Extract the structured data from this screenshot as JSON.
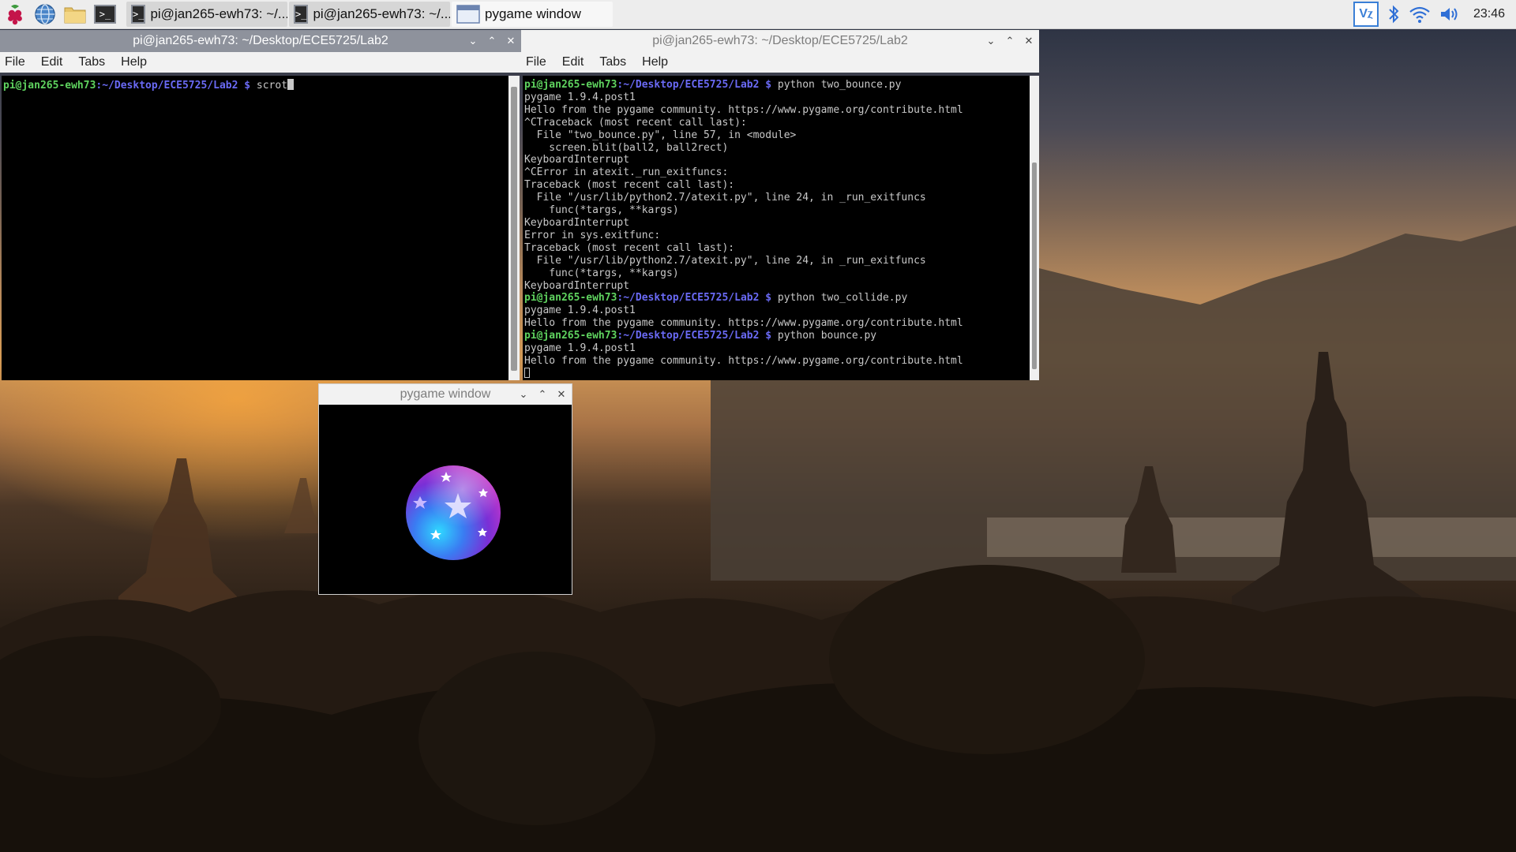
{
  "taskbar": {
    "tasks": [
      {
        "label": "pi@jan265-ewh73: ~/..."
      },
      {
        "label": "pi@jan265-ewh73: ~/..."
      },
      {
        "label": "pygame window"
      }
    ],
    "clock": "23:46"
  },
  "window_left": {
    "title": "pi@jan265-ewh73: ~/Desktop/ECE5725/Lab2",
    "menu": [
      "File",
      "Edit",
      "Tabs",
      "Help"
    ],
    "prompt_user": "pi@jan265-ewh73",
    "prompt_path": ":~/Desktop/ECE5725/Lab2 $ ",
    "command": "scrot"
  },
  "window_right": {
    "title": "pi@jan265-ewh73: ~/Desktop/ECE5725/Lab2",
    "menu": [
      "File",
      "Edit",
      "Tabs",
      "Help"
    ],
    "lines": [
      {
        "type": "prompt",
        "user": "pi@jan265-ewh73",
        "path": ":~/Desktop/ECE5725/Lab2 $ ",
        "cmd": "python two_bounce.py"
      },
      {
        "type": "out",
        "text": "pygame 1.9.4.post1"
      },
      {
        "type": "out",
        "text": "Hello from the pygame community. https://www.pygame.org/contribute.html"
      },
      {
        "type": "out",
        "text": "^CTraceback (most recent call last):"
      },
      {
        "type": "out",
        "text": "  File \"two_bounce.py\", line 57, in <module>"
      },
      {
        "type": "out",
        "text": "    screen.blit(ball2, ball2rect)"
      },
      {
        "type": "out",
        "text": "KeyboardInterrupt"
      },
      {
        "type": "out",
        "text": "^CError in atexit._run_exitfuncs:"
      },
      {
        "type": "out",
        "text": "Traceback (most recent call last):"
      },
      {
        "type": "out",
        "text": "  File \"/usr/lib/python2.7/atexit.py\", line 24, in _run_exitfuncs"
      },
      {
        "type": "out",
        "text": "    func(*targs, **kargs)"
      },
      {
        "type": "out",
        "text": "KeyboardInterrupt"
      },
      {
        "type": "out",
        "text": "Error in sys.exitfunc:"
      },
      {
        "type": "out",
        "text": "Traceback (most recent call last):"
      },
      {
        "type": "out",
        "text": "  File \"/usr/lib/python2.7/atexit.py\", line 24, in _run_exitfuncs"
      },
      {
        "type": "out",
        "text": "    func(*targs, **kargs)"
      },
      {
        "type": "out",
        "text": "KeyboardInterrupt"
      },
      {
        "type": "prompt",
        "user": "pi@jan265-ewh73",
        "path": ":~/Desktop/ECE5725/Lab2 $ ",
        "cmd": "python two_collide.py"
      },
      {
        "type": "out",
        "text": "pygame 1.9.4.post1"
      },
      {
        "type": "out",
        "text": "Hello from the pygame community. https://www.pygame.org/contribute.html"
      },
      {
        "type": "prompt",
        "user": "pi@jan265-ewh73",
        "path": ":~/Desktop/ECE5725/Lab2 $ ",
        "cmd": "python bounce.py"
      },
      {
        "type": "out",
        "text": "pygame 1.9.4.post1"
      },
      {
        "type": "out",
        "text": "Hello from the pygame community. https://www.pygame.org/contribute.html"
      }
    ]
  },
  "window_pygame": {
    "title": "pygame window"
  },
  "colors": {
    "prompt_user": "#5fd35f",
    "prompt_path": "#6a6af5",
    "terminal_bg": "#000000"
  }
}
